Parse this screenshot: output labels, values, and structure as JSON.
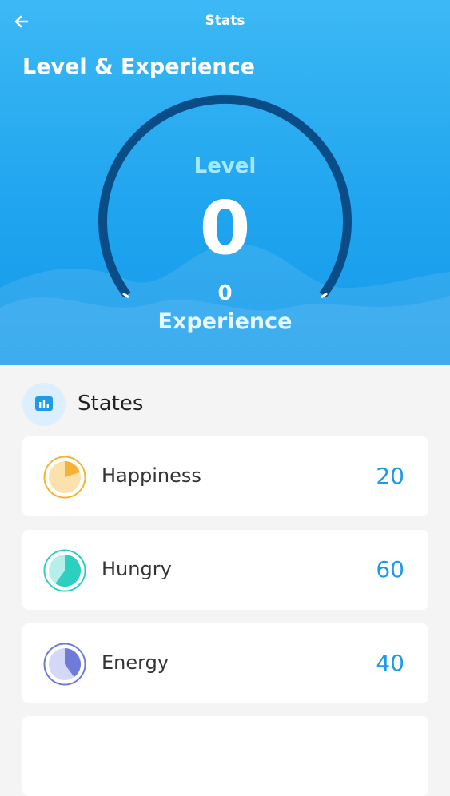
{
  "topbar": {
    "title": "Stats",
    "back_icon": "arrow-left-icon"
  },
  "level_section": {
    "title": "Level & Experience",
    "level_label": "Level",
    "level_value": "0",
    "experience_value": "0",
    "experience_label": "Experience"
  },
  "states": {
    "title": "States",
    "icon": "bar-chart-icon",
    "items": [
      {
        "label": "Happiness",
        "value": "20",
        "color": "#f5b335",
        "fill": 0.2
      },
      {
        "label": "Hungry",
        "value": "60",
        "color": "#2dd0c0",
        "fill": 0.6
      },
      {
        "label": "Energy",
        "value": "40",
        "color": "#6f7bd9",
        "fill": 0.4
      }
    ]
  },
  "colors": {
    "accent": "#1e9ae8",
    "header": "#21a5ef",
    "gauge": "#0a4c86"
  }
}
